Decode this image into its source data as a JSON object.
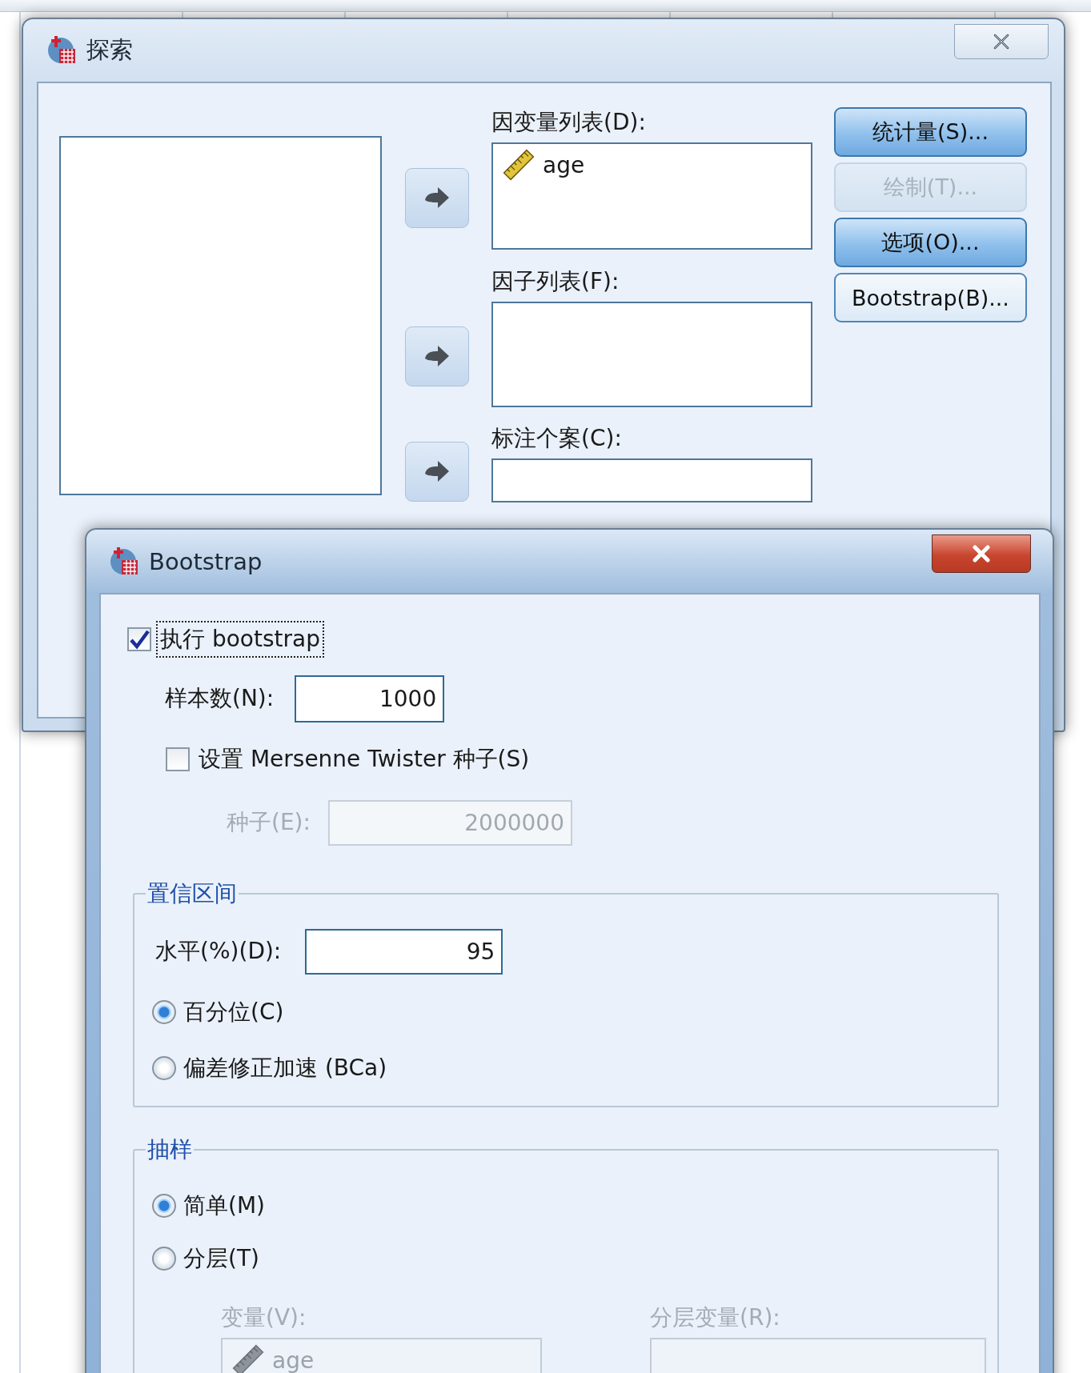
{
  "explore_window": {
    "title": "探索",
    "dependent_list": {
      "label": "因变量列表(D):",
      "items": [
        {
          "name": "age",
          "kind": "scale"
        }
      ]
    },
    "factor_list": {
      "label": "因子列表(F):"
    },
    "label_cases": {
      "label": "标注个案(C):"
    },
    "buttons": [
      {
        "label": "统计量(S)...",
        "disabled": false,
        "kind": "primary"
      },
      {
        "label": "绘制(T)...",
        "disabled": true,
        "kind": "primary"
      },
      {
        "label": "选项(O)...",
        "disabled": false,
        "kind": "primary"
      },
      {
        "label": "Bootstrap(B)...",
        "disabled": false,
        "kind": "plain"
      }
    ]
  },
  "bootstrap_window": {
    "title": "Bootstrap",
    "perform": {
      "label": "执行 bootstrap",
      "checked": true,
      "focused": true
    },
    "samples": {
      "label": "样本数(N):",
      "value": "1000",
      "disabled": false
    },
    "set_seed": {
      "label": "设置 Mersenne Twister 种子(S)",
      "checked": false,
      "focused": false
    },
    "seed": {
      "label": "种子(E):",
      "value": "2000000",
      "disabled": true
    },
    "confidence": {
      "title": "置信区间",
      "level": {
        "label": "水平(%)(D):",
        "value": "95",
        "disabled": false
      },
      "options": [
        {
          "label": "百分位(C)",
          "selected": true
        },
        {
          "label": "偏差修正加速 (BCa)",
          "selected": false
        }
      ]
    },
    "sampling": {
      "title": "抽样",
      "options": [
        {
          "label": "简单(M)",
          "selected": true
        },
        {
          "label": "分层(T)",
          "selected": false
        }
      ],
      "variables": {
        "label": "变量(V):",
        "disabled": true,
        "items": [
          {
            "name": "age",
            "kind": "scale"
          }
        ]
      },
      "strata": {
        "label": "分层变量(R):",
        "disabled": true
      }
    }
  }
}
